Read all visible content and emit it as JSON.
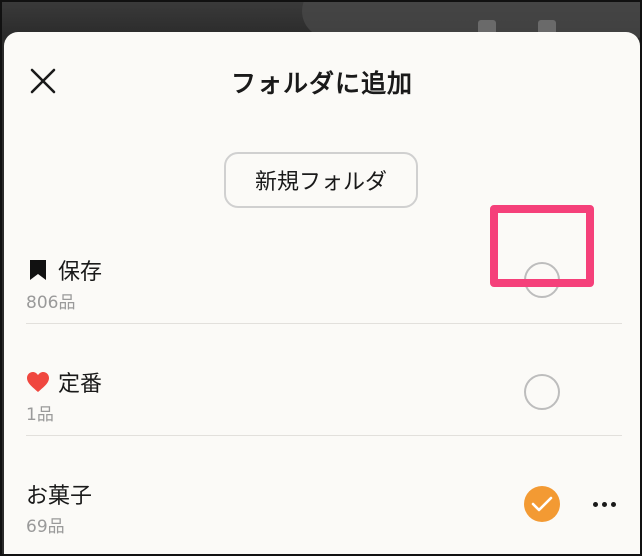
{
  "header": {
    "title": "フォルダに追加"
  },
  "actions": {
    "new_folder_label": "新規フォルダ"
  },
  "folders": [
    {
      "name": "保存",
      "count": "806品",
      "icon": "bookmark-icon",
      "selected": false,
      "highlighted": true
    },
    {
      "name": "定番",
      "count": "1品",
      "icon": "heart-icon",
      "icon_color": "#f0473f",
      "selected": false
    },
    {
      "name": "お菓子",
      "count": "69品",
      "icon": null,
      "selected": true,
      "has_more_menu": true
    }
  ],
  "colors": {
    "accent": "#f39a33",
    "highlight": "#f5407a",
    "heart": "#f0473f"
  }
}
